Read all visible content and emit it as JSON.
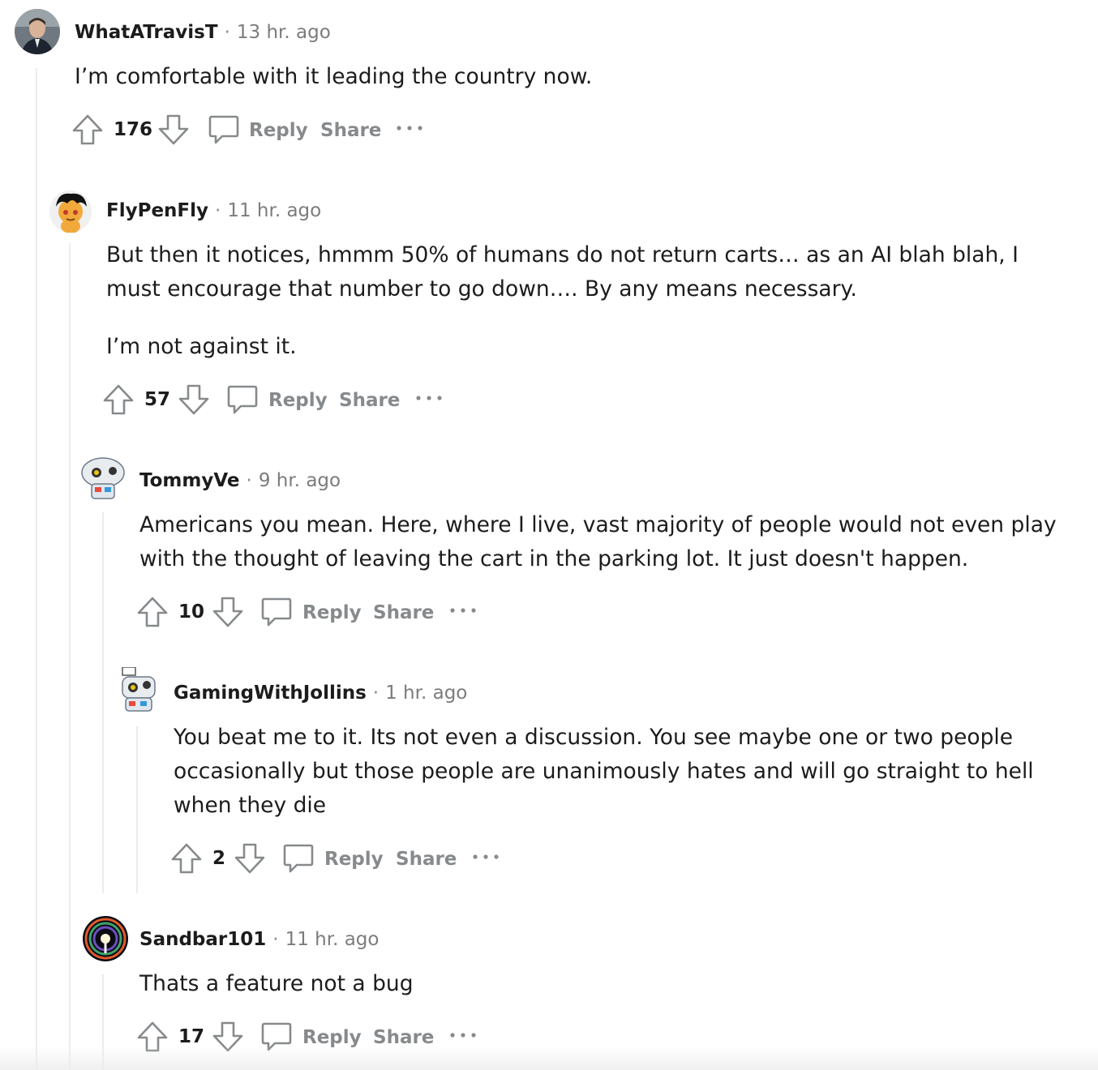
{
  "comments": [
    {
      "username": "WhatATravisT",
      "separator": "·",
      "time": "13 hr. ago",
      "paragraphs": [
        "I’m comfortable with it leading the country now."
      ],
      "score": "176",
      "reply_label": "Reply",
      "share_label": "Share",
      "avatar_icon": "person-photo-avatar"
    },
    {
      "username": "FlyPenFly",
      "separator": "·",
      "time": "11 hr. ago",
      "paragraphs": [
        "But then it notices, hmmm 50% of humans do not return carts… as an AI blah blah, I must encourage that number to go down…. By any means necessary.",
        "I’m not against it."
      ],
      "score": "57",
      "reply_label": "Reply",
      "share_label": "Share",
      "avatar_icon": "snoo-avatar"
    },
    {
      "username": "TommyVe",
      "separator": "·",
      "time": "9 hr. ago",
      "paragraphs": [
        "Americans you mean. Here, where I live, vast majority of people would not even play with the thought of leaving the cart in the parking lot. It just doesn't happen."
      ],
      "score": "10",
      "reply_label": "Reply",
      "share_label": "Share",
      "avatar_icon": "robot-snoo-avatar"
    },
    {
      "username": "GamingWithJollins",
      "separator": "·",
      "time": "1 hr. ago",
      "paragraphs": [
        "You beat me to it. Its not even a discussion. You see maybe one or two people occasionally but those people are unanimously hates and will go straight to hell when they die"
      ],
      "score": "2",
      "reply_label": "Reply",
      "share_label": "Share",
      "avatar_icon": "robot-snoo-avatar"
    },
    {
      "username": "Sandbar101",
      "separator": "·",
      "time": "11 hr. ago",
      "paragraphs": [
        "Thats a feature not a bug"
      ],
      "score": "17",
      "reply_label": "Reply",
      "share_label": "Share",
      "avatar_icon": "galaxy-photo-avatar"
    }
  ],
  "colors": {
    "text": "#1c1c1c",
    "muted": "#878a8c",
    "thread_line": "#ececec"
  }
}
